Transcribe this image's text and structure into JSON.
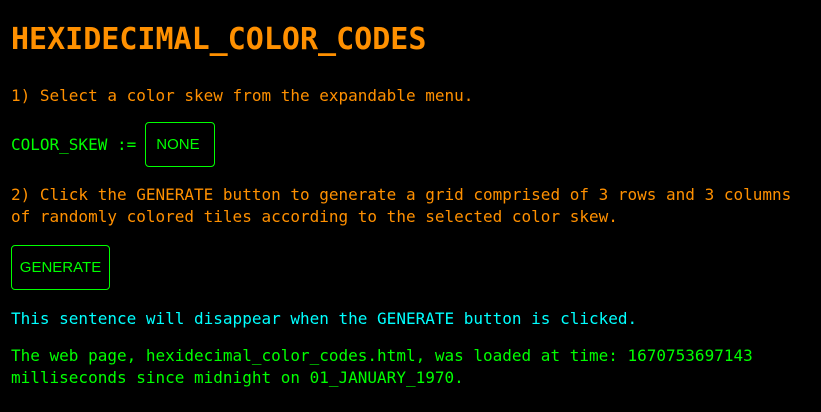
{
  "page": {
    "title": "HEXIDECIMAL_COLOR_CODES"
  },
  "step1": {
    "text": "1) Select a color skew from the expandable menu."
  },
  "color_skew": {
    "label": "COLOR_SKEW :=",
    "selected": "NONE"
  },
  "step2": {
    "line1": "2) Click the GENERATE button to generate a grid comprised of 3 rows and 3 columns",
    "line2": "of randomly colored tiles according to the selected color skew."
  },
  "generate": {
    "label": "GENERATE"
  },
  "notice": {
    "text": "This sentence will disappear when the GENERATE button is clicked."
  },
  "load_info": {
    "line1": "The web page, hexidecimal_color_codes.html, was loaded at time: 1670753697143",
    "line2": "milliseconds since midnight on 01_JANUARY_1970."
  },
  "colors": {
    "background": "#000000",
    "heading": "#ff9000",
    "instruction": "#ff9000",
    "control": "#00ff00",
    "notice": "#00ffff",
    "load_info": "#00ff00"
  }
}
